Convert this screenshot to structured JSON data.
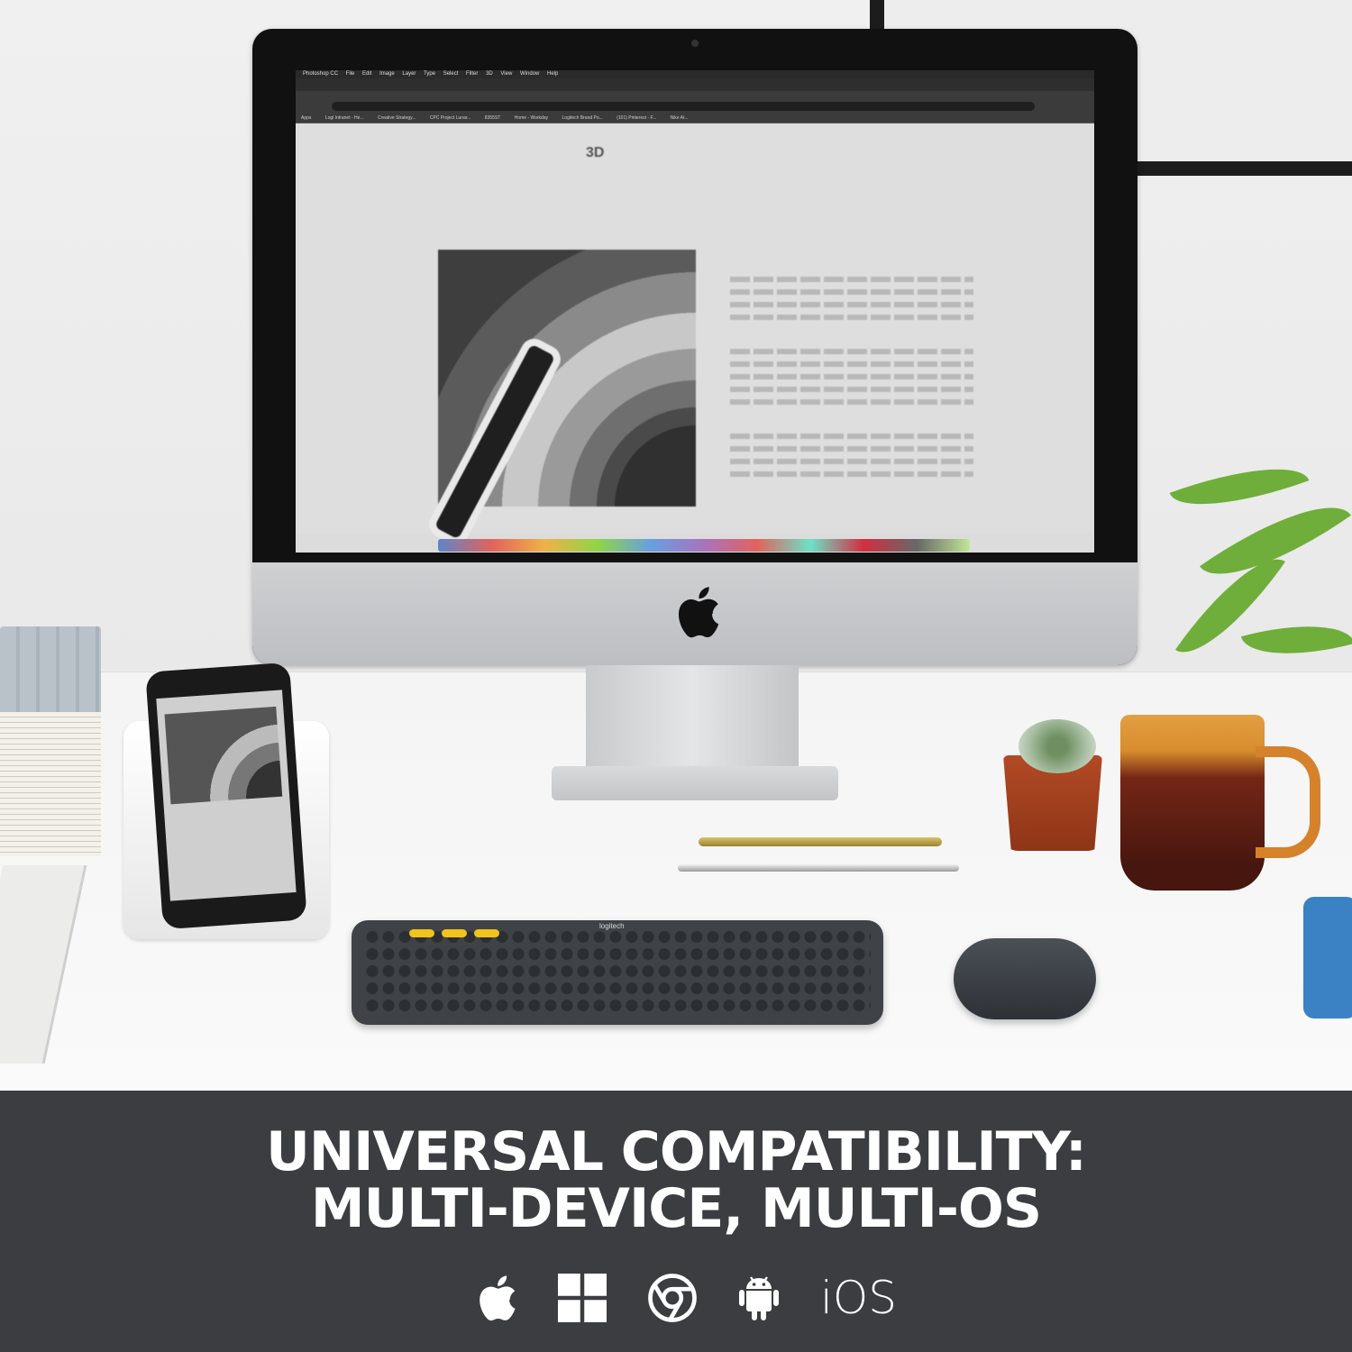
{
  "photo": {
    "screen_menubar": [
      "Photoshop CC",
      "File",
      "Edit",
      "Image",
      "Layer",
      "Type",
      "Select",
      "Filter",
      "3D",
      "View",
      "Window",
      "Help"
    ],
    "screen_bookmarks": [
      "Apps",
      "Logi Intranet - He...",
      "Creative Strategy...",
      "CPC Project Lunar...",
      "8355ST",
      "Home - Workday",
      "Logitech Brand Po...",
      "(101) Pinterest - F...",
      "Nike At..."
    ],
    "screen_heading": "3D",
    "keyboard_brand": "logitech"
  },
  "banner": {
    "line1": "UNIVERSAL COMPATIBILITY:",
    "line2": "MULTI-DEVICE, MULTI-OS",
    "os_icons": [
      "apple-icon",
      "windows-icon",
      "chrome-icon",
      "android-icon"
    ],
    "ios_label": "iOS",
    "background": "#3b3d40",
    "text_color": "#ffffff"
  }
}
